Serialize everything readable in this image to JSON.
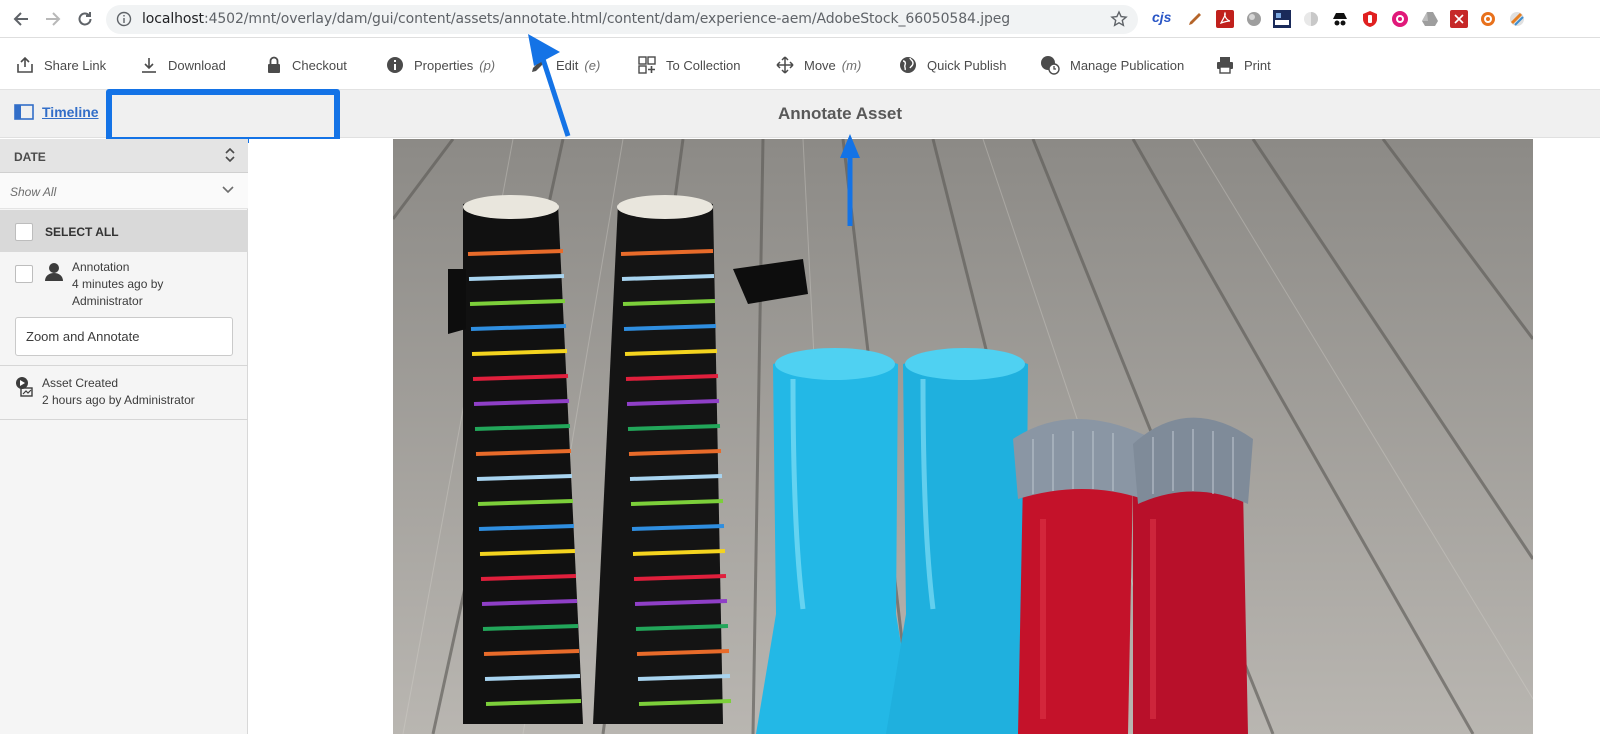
{
  "browser": {
    "url_host": "localhost",
    "url_rest": ":4502/mnt/overlay/dam/gui/content/assets/annotate.html/content/dam/experience-aem/AdobeStock_66050584.jpeg",
    "extension_cjs": "cjs"
  },
  "actions": [
    {
      "label": "Share Link",
      "key": ""
    },
    {
      "label": "Download",
      "key": ""
    },
    {
      "label": "Checkout",
      "key": ""
    },
    {
      "label": "Properties",
      "key": "(p)"
    },
    {
      "label": "Edit",
      "key": "(e)"
    },
    {
      "label": "To Collection",
      "key": ""
    },
    {
      "label": "Move",
      "key": "(m)"
    },
    {
      "label": "Quick Publish",
      "key": ""
    },
    {
      "label": "Manage Publication",
      "key": ""
    },
    {
      "label": "Print",
      "key": ""
    }
  ],
  "header": {
    "timeline_label": "Timeline",
    "title": "Annotate Asset"
  },
  "sidebar": {
    "date_label": "DATE",
    "filter_value": "Show All",
    "select_all_label": "SELECT ALL",
    "entries": [
      {
        "title": "Annotation",
        "meta1": "4 minutes ago by",
        "meta2": "Administrator",
        "comment": "Zoom and Annotate"
      },
      {
        "title": "Asset Created",
        "meta1": "2 hours ago by Administrator"
      }
    ]
  },
  "colors": {
    "accent_blue": "#1473e6",
    "link_blue": "#326ec8"
  }
}
